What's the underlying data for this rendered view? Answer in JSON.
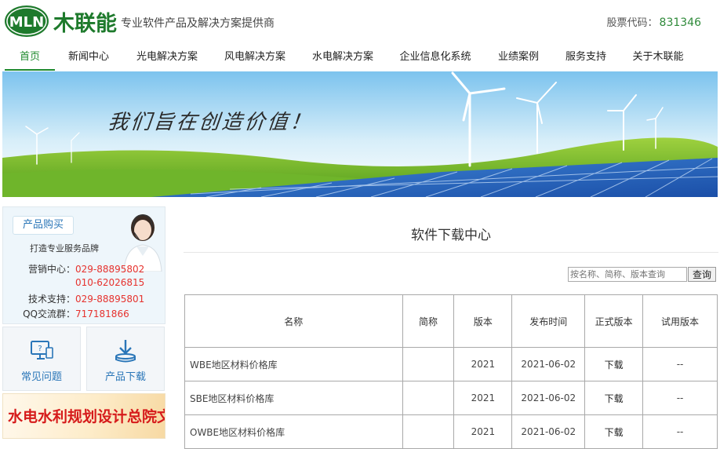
{
  "header": {
    "logo_text": "MLN",
    "brand_name": "木联能",
    "slogan": "专业软件产品及解决方案提供商",
    "stock_label": "股票代码：",
    "stock_code": "831346"
  },
  "nav": {
    "items": [
      {
        "label": "首页",
        "active": true
      },
      {
        "label": "新闻中心"
      },
      {
        "label": "光电解决方案"
      },
      {
        "label": "风电解决方案"
      },
      {
        "label": "水电解决方案"
      },
      {
        "label": "企业信息化系统"
      },
      {
        "label": "业绩案例"
      },
      {
        "label": "服务支持"
      },
      {
        "label": "关于木联能"
      }
    ]
  },
  "banner": {
    "text": "我们旨在创造价值！"
  },
  "sidebar": {
    "buy_tag": "产品购买",
    "brand_line": "打造专业服务品牌",
    "sales_label": "营销中心：",
    "sales_phone_1": "029-88895802",
    "sales_phone_2": "010-62026815",
    "support_label": "技术支持：",
    "support_phone": "029-88895801",
    "qq_label": "QQ交流群：",
    "qq_group": "717181866",
    "faq_label": "常见问题",
    "download_label": "产品下载",
    "water_banner_text": "水电水利规划设计总院文件"
  },
  "main": {
    "title": "软件下载中心",
    "search_placeholder": "按名称、简称、版本查询",
    "search_button": "查询",
    "columns": [
      "名称",
      "简称",
      "版本",
      "发布时间",
      "正式版本",
      "试用版本"
    ],
    "rows": [
      {
        "name": "WBE地区材料价格库",
        "abbr": "",
        "version": "2021",
        "date": "2021-06-02",
        "official": "下载",
        "trial": "--"
      },
      {
        "name": "SBE地区材料价格库",
        "abbr": "",
        "version": "2021",
        "date": "2021-06-02",
        "official": "下载",
        "trial": "--"
      },
      {
        "name": "OWBE地区材料价格库",
        "abbr": "",
        "version": "2021",
        "date": "2021-06-02",
        "official": "下载",
        "trial": "--"
      }
    ]
  },
  "colors": {
    "brand_green": "#1f8a2e",
    "link_blue": "#2a76b8",
    "phone_red": "#e6322e"
  }
}
